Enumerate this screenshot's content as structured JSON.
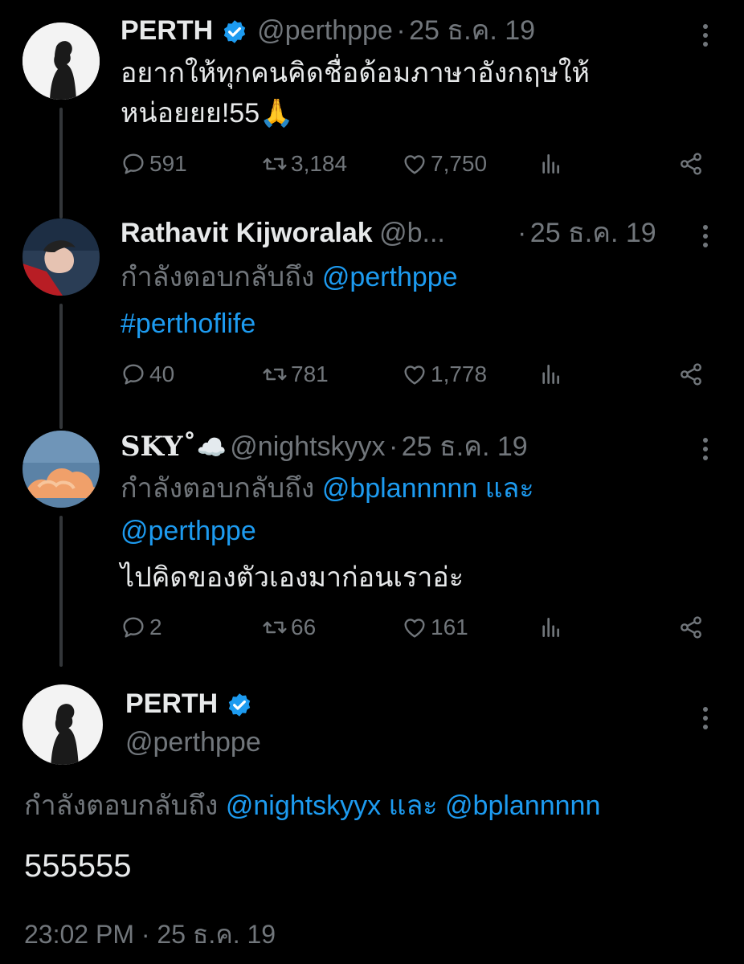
{
  "tweets": [
    {
      "name": "PERTH",
      "verified": true,
      "handle": "@perthppe",
      "sep": "·",
      "date": "25 ธ.ค. 19",
      "line1": "อยากให้ทุกคนคิดชื่อด้อมภาษาอังกฤษให้",
      "line2": "หน่อยยย!55",
      "emoji": "🙏",
      "replies": "591",
      "retweets": "3,184",
      "likes": "7,750"
    },
    {
      "name": "Rathavit Kijworalak",
      "handle": "@b...",
      "sep": "·",
      "date": "25 ธ.ค. 19",
      "reply_prefix": "กำลังตอบกลับถึง",
      "reply_to": "@perthppe",
      "hashtag": "#perthoflife",
      "replies": "40",
      "retweets": "781",
      "likes": "1,778"
    },
    {
      "name": "SKY˚",
      "cloud": "☁️",
      "handle": "@nightskyyx",
      "sep": "·",
      "date": "25 ธ.ค. 19",
      "reply_prefix": "กำลังตอบกลับถึง",
      "reply_to_1": "@bplannnnn",
      "and_word": "และ",
      "reply_to_2": "@perthppe",
      "text": "ไปคิดของตัวเองมาก่อนเราอ่ะ",
      "replies": "2",
      "retweets": "66",
      "likes": "161"
    }
  ],
  "main": {
    "name": "PERTH",
    "verified": true,
    "handle": "@perthppe",
    "reply_prefix": "กำลังตอบกลับถึง",
    "reply_to_1": "@nightskyyx",
    "and_word": "และ",
    "reply_to_2": "@bplannnnn",
    "text": "555555",
    "time": "23:02 PM",
    "sep": "·",
    "date": "25 ธ.ค. 19"
  },
  "colors": {
    "background": "#000000",
    "text": "#e7e9ea",
    "muted": "#71767b",
    "link": "#1d9bf0",
    "verified": "#1d9bf0"
  },
  "icons": [
    "reply-icon",
    "retweet-icon",
    "like-icon",
    "views-icon",
    "share-icon",
    "more-icon",
    "verified-icon"
  ]
}
